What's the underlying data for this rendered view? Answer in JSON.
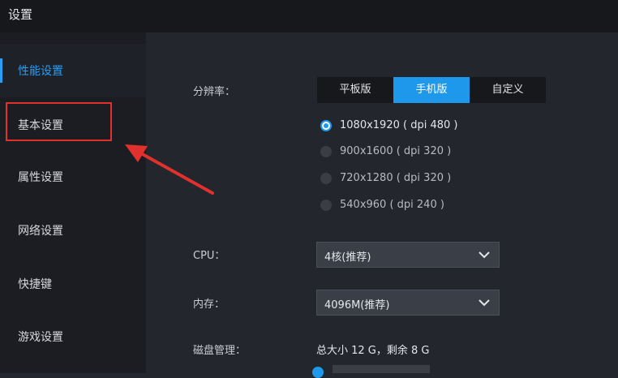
{
  "window": {
    "title": "设置"
  },
  "sidebar": {
    "items": [
      {
        "label": "性能设置",
        "active": true
      },
      {
        "label": "基本设置",
        "active": false
      },
      {
        "label": "属性设置",
        "active": false
      },
      {
        "label": "网络设置",
        "active": false
      },
      {
        "label": "快捷键",
        "active": false
      },
      {
        "label": "游戏设置",
        "active": false
      }
    ]
  },
  "resolution": {
    "label": "分辨率：",
    "modes": [
      {
        "label": "平板版",
        "active": false
      },
      {
        "label": "手机版",
        "active": true
      },
      {
        "label": "自定义",
        "active": false
      }
    ],
    "options": [
      {
        "label": "1080x1920 ( dpi 480 )",
        "checked": true
      },
      {
        "label": "900x1600 ( dpi 320 )",
        "checked": false
      },
      {
        "label": "720x1280 ( dpi 320 )",
        "checked": false
      },
      {
        "label": "540x960 ( dpi 240 )",
        "checked": false
      }
    ]
  },
  "cpu": {
    "label": "CPU：",
    "value": "4核(推荐)"
  },
  "memory": {
    "label": "内存：",
    "value": "4096M(推荐)"
  },
  "disk": {
    "label": "磁盘管理：",
    "info": "总大小 12 G，剩余 8 G"
  },
  "colors": {
    "accent": "#1e98ea",
    "highlight": "#e0312c",
    "background": "#23262d",
    "sidebar": "#1b1d22"
  }
}
